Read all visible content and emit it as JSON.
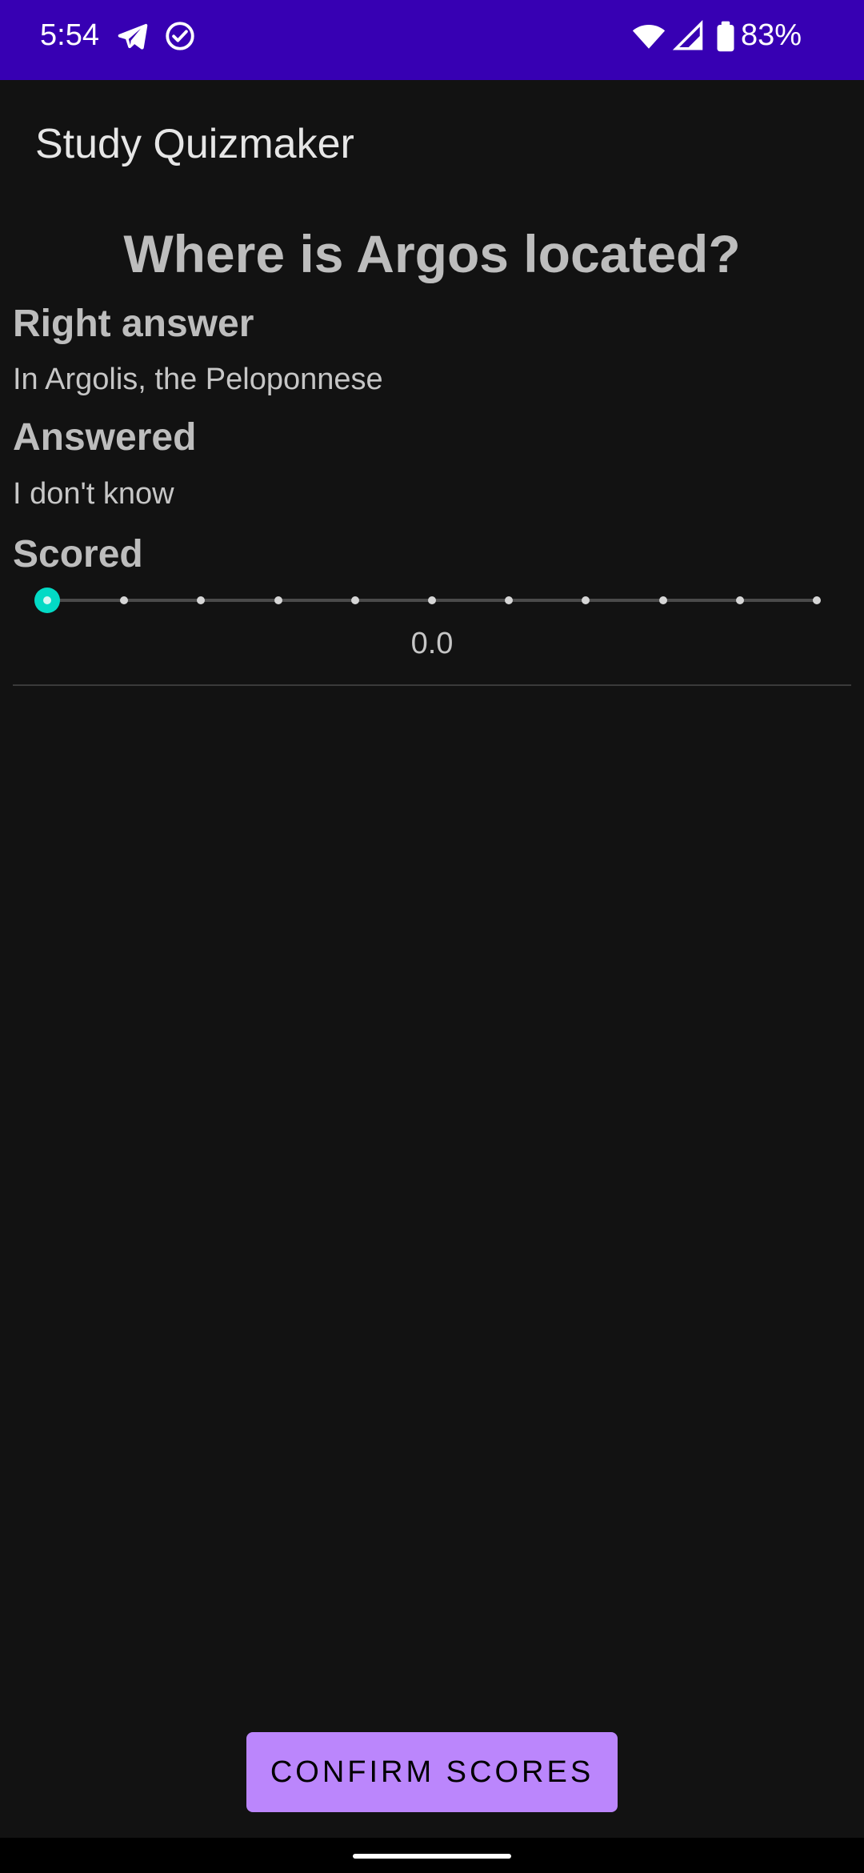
{
  "status_bar": {
    "time": "5:54",
    "battery": "83%",
    "icons": [
      "telegram-icon",
      "check-circle-icon",
      "wifi-icon",
      "signal-icon",
      "battery-icon"
    ]
  },
  "app_bar": {
    "title": "Study Quizmaker"
  },
  "question": {
    "text": "Where is Argos located?"
  },
  "right_answer": {
    "label": "Right answer",
    "value": "In Argolis, the Peloponnese"
  },
  "answered": {
    "label": "Answered",
    "value": "I don't know"
  },
  "scored": {
    "label": "Scored",
    "value_text": "0.0",
    "slider": {
      "min": 0,
      "max": 1,
      "step": 0.1,
      "value": 0
    }
  },
  "confirm_button": {
    "label": "CONFIRM SCORES"
  },
  "colors": {
    "status_bar": "#3700b3",
    "background": "#121212",
    "accent": "#03dac5",
    "button": "#bb86fc"
  }
}
